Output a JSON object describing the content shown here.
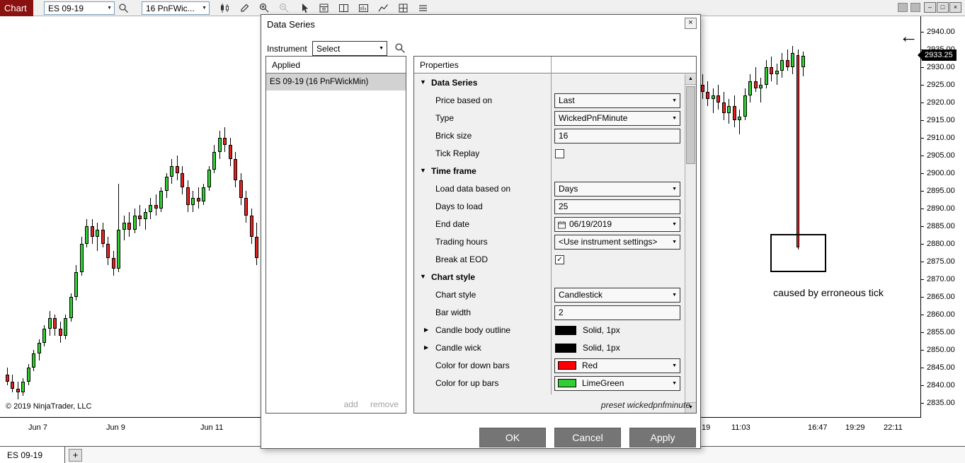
{
  "toolbar": {
    "chart_label": "Chart",
    "instrument_dropdown": "ES 09-19",
    "series_dropdown": "16 PnFWic...",
    "icons": [
      "candlestick-chart",
      "drawing-tools",
      "zoom-in",
      "zoom-out",
      "pointer",
      "data-box",
      "panel-layout",
      "indicator-panel",
      "line-chart",
      "grid",
      "log"
    ]
  },
  "window_controls": {
    "minimize": "–",
    "maximize": "□",
    "close": "×"
  },
  "dialog": {
    "title": "Data Series",
    "close": "×",
    "instrument": {
      "label": "Instrument",
      "value": "Select"
    },
    "applied": {
      "header": "Applied",
      "items": [
        "ES 09-19 (16 PnFWickMin)"
      ],
      "add": "add",
      "remove": "remove"
    },
    "properties": {
      "header": "Properties",
      "preset": "preset wickedpnfminute",
      "sections": [
        {
          "title": "Data Series",
          "rows": [
            {
              "label": "Price based on",
              "control": "dropdown",
              "value": "Last"
            },
            {
              "label": "Type",
              "control": "dropdown",
              "value": "WickedPnFMinute"
            },
            {
              "label": "Brick size",
              "control": "input",
              "value": "16"
            },
            {
              "label": "Tick Replay",
              "control": "checkbox",
              "checked": false
            }
          ]
        },
        {
          "title": "Time frame",
          "rows": [
            {
              "label": "Load data based on",
              "control": "dropdown",
              "value": "Days"
            },
            {
              "label": "Days to load",
              "control": "input",
              "value": "25"
            },
            {
              "label": "End date",
              "control": "datepicker",
              "value": "06/19/2019"
            },
            {
              "label": "Trading hours",
              "control": "dropdown",
              "value": "<Use instrument settings>"
            },
            {
              "label": "Break at EOD",
              "control": "checkbox",
              "checked": true
            }
          ]
        },
        {
          "title": "Chart style",
          "rows": [
            {
              "label": "Chart style",
              "control": "dropdown",
              "value": "Candlestick"
            },
            {
              "label": "Bar width",
              "control": "input",
              "value": "2"
            },
            {
              "label": "Candle body outline",
              "control": "swatch",
              "value": "Solid, 1px",
              "swatch": "#000000",
              "expandable": true
            },
            {
              "label": "Candle wick",
              "control": "swatch",
              "value": "Solid, 1px",
              "swatch": "#000000",
              "expandable": true
            },
            {
              "label": "Color for down bars",
              "control": "colordropdown",
              "value": "Red",
              "swatch": "#ff0000"
            },
            {
              "label": "Color for up bars",
              "control": "colordropdown",
              "value": "LimeGreen",
              "swatch": "#32cd32"
            }
          ]
        }
      ]
    },
    "buttons": [
      "OK",
      "Cancel",
      "Apply"
    ]
  },
  "chart": {
    "copyright": "© 2019 NinjaTrader, LLC",
    "annotation": "caused by erroneous tick",
    "arrow_annotation": "←",
    "price_marker": "2933.25",
    "x_labels_left": [
      "Jun 7",
      "Jun 9",
      "Jun 11"
    ],
    "x_labels_right": [
      "19",
      "11:03",
      "16:47",
      "19:29",
      "22:11"
    ],
    "y_axis": [
      "2940.00",
      "2935.00",
      "2930.00",
      "2925.00",
      "2920.00",
      "2915.00",
      "2910.00",
      "2905.00",
      "2900.00",
      "2895.00",
      "2890.00",
      "2885.00",
      "2880.00",
      "2875.00",
      "2870.00",
      "2865.00",
      "2860.00",
      "2855.00",
      "2850.00",
      "2845.00",
      "2840.00",
      "2835.00"
    ],
    "tab": {
      "label": "ES 09-19",
      "add": "+"
    }
  },
  "chart_data": {
    "type": "candlestick",
    "price_range": [
      2835,
      2940
    ],
    "up_color": "#32cd32",
    "down_color": "#e32222",
    "left_candles": [
      [
        2843,
        2845,
        2840,
        2841
      ],
      [
        2841,
        2843,
        2838,
        2839
      ],
      [
        2839,
        2841,
        2836,
        2838
      ],
      [
        2838,
        2842,
        2837,
        2841
      ],
      [
        2841,
        2846,
        2840,
        2845
      ],
      [
        2845,
        2850,
        2844,
        2849
      ],
      [
        2849,
        2853,
        2847,
        2852
      ],
      [
        2852,
        2857,
        2851,
        2856
      ],
      [
        2856,
        2861,
        2854,
        2859
      ],
      [
        2859,
        2860,
        2854,
        2856
      ],
      [
        2856,
        2858,
        2852,
        2854
      ],
      [
        2854,
        2860,
        2853,
        2859
      ],
      [
        2859,
        2866,
        2858,
        2865
      ],
      [
        2865,
        2874,
        2864,
        2872
      ],
      [
        2872,
        2882,
        2871,
        2880
      ],
      [
        2880,
        2887,
        2879,
        2885
      ],
      [
        2885,
        2887,
        2880,
        2882
      ],
      [
        2882,
        2886,
        2878,
        2884
      ],
      [
        2884,
        2886,
        2879,
        2880
      ],
      [
        2880,
        2882,
        2874,
        2876
      ],
      [
        2876,
        2878,
        2871,
        2873
      ],
      [
        2873,
        2897,
        2872,
        2884
      ],
      [
        2884,
        2888,
        2881,
        2886
      ],
      [
        2886,
        2889,
        2882,
        2884
      ],
      [
        2884,
        2890,
        2883,
        2888
      ],
      [
        2888,
        2891,
        2885,
        2887
      ],
      [
        2887,
        2890,
        2884,
        2889
      ],
      [
        2889,
        2893,
        2887,
        2891
      ],
      [
        2891,
        2894,
        2888,
        2890
      ],
      [
        2890,
        2896,
        2889,
        2895
      ],
      [
        2895,
        2900,
        2893,
        2899
      ],
      [
        2899,
        2904,
        2897,
        2902
      ],
      [
        2902,
        2905,
        2898,
        2900
      ],
      [
        2900,
        2902,
        2894,
        2896
      ],
      [
        2896,
        2898,
        2889,
        2891
      ],
      [
        2891,
        2895,
        2889,
        2893
      ],
      [
        2893,
        2896,
        2890,
        2892
      ],
      [
        2892,
        2897,
        2891,
        2896
      ],
      [
        2896,
        2902,
        2895,
        2901
      ],
      [
        2901,
        2908,
        2900,
        2906
      ],
      [
        2906,
        2912,
        2904,
        2910
      ],
      [
        2910,
        2913,
        2906,
        2908
      ],
      [
        2908,
        2910,
        2902,
        2904
      ],
      [
        2904,
        2906,
        2896,
        2898
      ],
      [
        2898,
        2900,
        2891,
        2893
      ],
      [
        2893,
        2895,
        2886,
        2888
      ],
      [
        2888,
        2890,
        2880,
        2882
      ],
      [
        2882,
        2886,
        2874,
        2876
      ]
    ],
    "right_candles": [
      [
        2925,
        2928,
        2921,
        2923
      ],
      [
        2923,
        2926,
        2919,
        2921
      ],
      [
        2921,
        2924,
        2917,
        2922
      ],
      [
        2922,
        2925,
        2918,
        2920
      ],
      [
        2920,
        2923,
        2915,
        2917
      ],
      [
        2917,
        2921,
        2914,
        2919
      ],
      [
        2919,
        2922,
        2913,
        2915
      ],
      [
        2915,
        2918,
        2911,
        2916
      ],
      [
        2916,
        2924,
        2915,
        2922
      ],
      [
        2922,
        2928,
        2920,
        2926
      ],
      [
        2926,
        2930,
        2923,
        2924
      ],
      [
        2924,
        2927,
        2920,
        2925
      ],
      [
        2925,
        2932,
        2924,
        2930
      ],
      [
        2930,
        2933,
        2926,
        2928
      ],
      [
        2928,
        2931,
        2925,
        2929
      ],
      [
        2929,
        2934,
        2927,
        2932
      ],
      [
        2932,
        2935,
        2929,
        2930
      ],
      [
        2930,
        2936,
        2928,
        2934
      ],
      [
        2933.5,
        2935,
        2878.5,
        2879,
        4
      ],
      [
        2930,
        2934.5,
        2927.5,
        2933.25
      ]
    ]
  }
}
